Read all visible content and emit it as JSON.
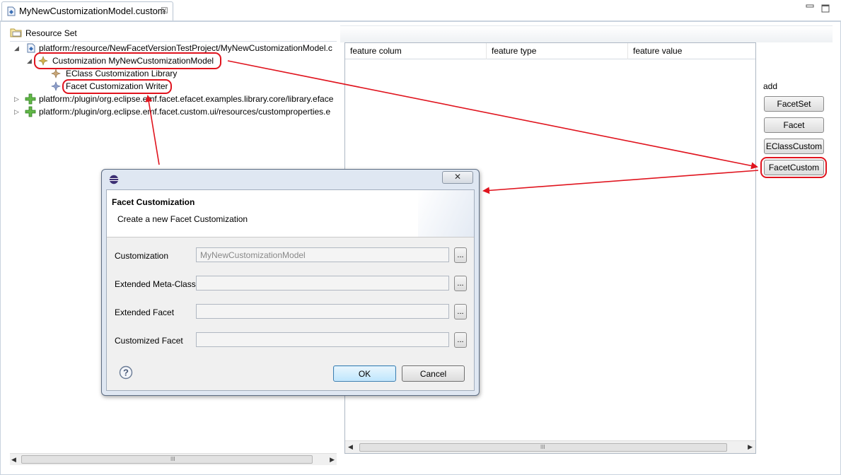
{
  "editor_tab": {
    "title": "MyNewCustomizationModel.custom",
    "close": "☒"
  },
  "tree": {
    "root_label": "Resource Set",
    "items": [
      {
        "label": "platform:/resource/NewFacetVersionTestProject/MyNewCustomizationModel.c",
        "expanded": true
      },
      {
        "label": "Customization MyNewCustomizationModel",
        "expanded": true,
        "highlight": true
      },
      {
        "label": "EClass Customization Library"
      },
      {
        "label": "Facet Customization Writer",
        "highlight": true
      },
      {
        "label": "platform:/plugin/org.eclipse.emf.facet.efacet.examples.library.core/library.eface",
        "expanded": false
      },
      {
        "label": "platform:/plugin/org.eclipse.emf.facet.custom.ui/resources/customproperties.e",
        "expanded": false
      }
    ],
    "scroll_grip": "III"
  },
  "table": {
    "columns": [
      "feature colum",
      "feature type",
      "feature value"
    ],
    "scroll_grip": "III"
  },
  "add_panel": {
    "label": "add",
    "buttons": [
      "FacetSet",
      "Facet",
      "EClassCustom",
      "FacetCustom"
    ]
  },
  "dialog": {
    "close": "✕",
    "title": "Facet Customization",
    "subtitle": "Create a new Facet Customization",
    "fields": [
      {
        "label": "Customization",
        "value": "MyNewCustomizationModel",
        "browse": "..."
      },
      {
        "label": "Extended Meta-Class",
        "value": "",
        "browse": "..."
      },
      {
        "label": "Extended Facet",
        "value": "",
        "browse": "..."
      },
      {
        "label": "Customized Facet",
        "value": "",
        "browse": "..."
      }
    ],
    "help_icon": "?",
    "ok": "OK",
    "cancel": "Cancel"
  },
  "colors": {
    "highlight": "#e0141e",
    "ok_border": "#3c7fb1",
    "dialog_frame": "#dfe7f2"
  }
}
